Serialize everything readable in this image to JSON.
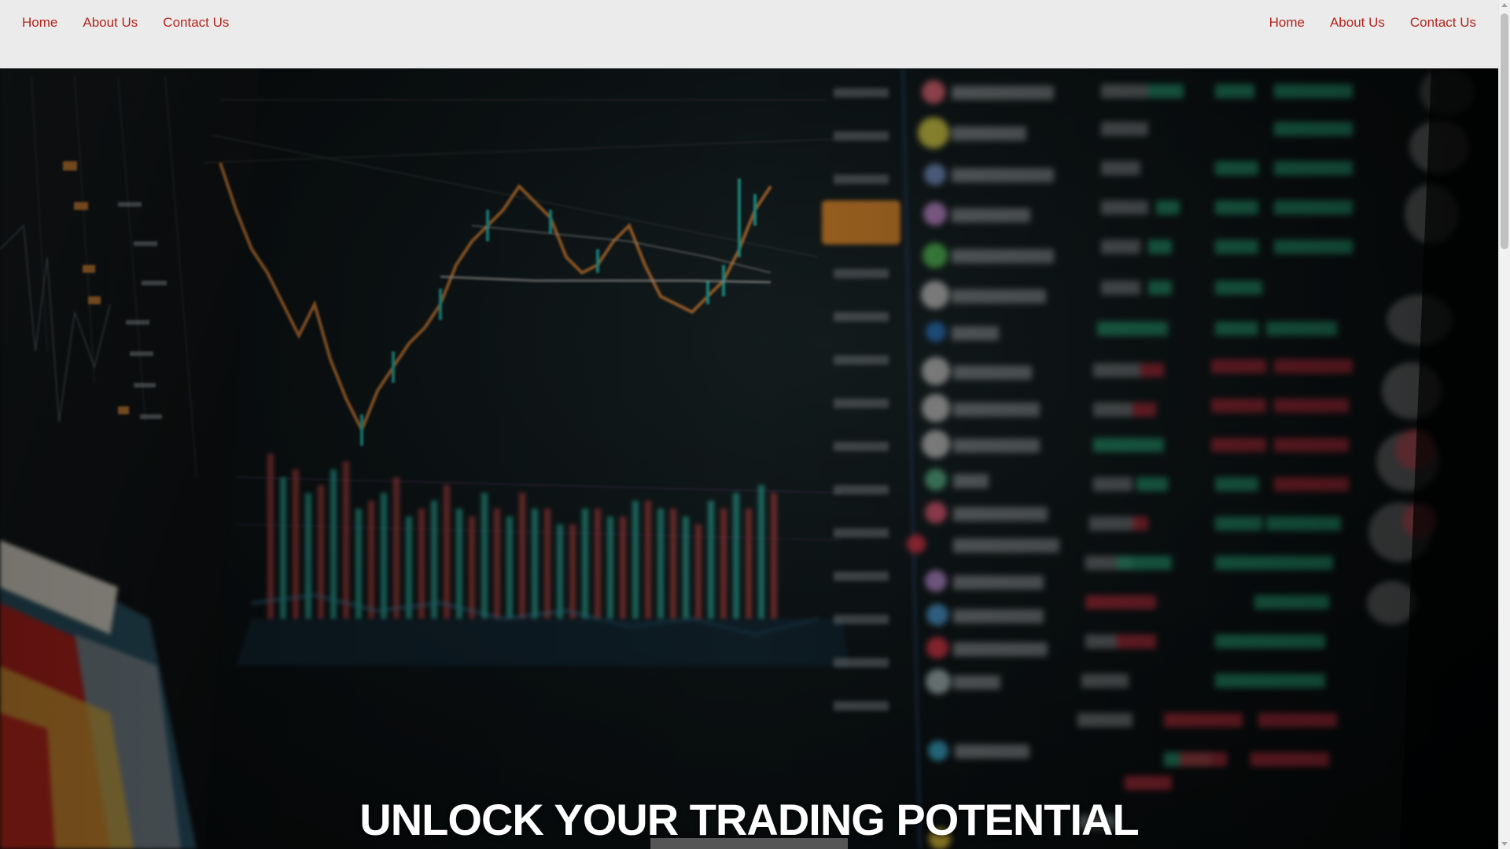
{
  "nav_left": {
    "home": "Home",
    "about": "About Us",
    "contact": "Contact Us"
  },
  "nav_right": {
    "home": "Home",
    "about": "About Us",
    "contact": "Contact Us"
  },
  "hero": {
    "title": "UNLOCK YOUR TRADING POTENTIAL",
    "background_image": "stock-market-trading-screens"
  },
  "colors": {
    "header_bg": "#ebebeb",
    "nav_link": "#b3261e",
    "hero_title": "#ffffff",
    "cta_button": "#555555"
  }
}
